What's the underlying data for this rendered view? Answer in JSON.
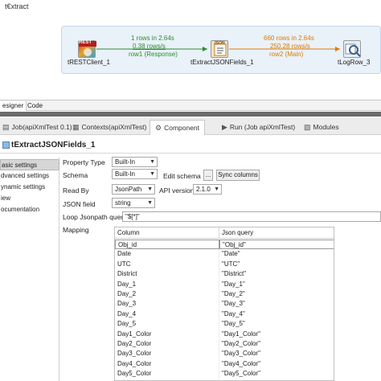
{
  "canvas": {
    "title": "t€xtract",
    "components": {
      "rest": {
        "label": "tRESTClient_1",
        "badge": "REST"
      },
      "extract": {
        "label": "tExtractJSONFields_1",
        "badge": "JSON"
      },
      "log": {
        "label": "tLogRow_3"
      }
    },
    "flow1": {
      "rows": "1 rows in 2.64s",
      "rate": "0.38 rows/s",
      "name": "row1 (Response)"
    },
    "flow2": {
      "rows": "660 rows in 2.64s",
      "rate": "250.28 rows/s",
      "name": "row2 (Main)"
    },
    "colors": {
      "flow_green": "#2e8b2e",
      "flow_orange": "#e07a00",
      "job_bg": "#e9f1f9"
    }
  },
  "designer_tabs": [
    "esigner",
    "Code"
  ],
  "view_tabs": [
    {
      "label": "Job(apiXmlTest 0.1)",
      "icon": "job-icon"
    },
    {
      "label": "Contexts(apiXmlTest)",
      "icon": "contexts-icon"
    },
    {
      "label": "Component",
      "icon": "component-icon"
    },
    {
      "label": "Run (Job apiXmlTest)",
      "icon": "run-icon"
    },
    {
      "label": "Modules",
      "icon": "modules-icon"
    }
  ],
  "component_title": "tExtractJSONFields_1",
  "settings_nav": [
    "asic settings",
    "dvanced settings",
    "ynamic settings",
    "iew",
    "ocumentation"
  ],
  "form": {
    "property_type_label": "Property Type",
    "property_type_value": "Built-In",
    "schema_label": "Schema",
    "schema_value": "Built-In",
    "edit_schema_label": "Edit schema",
    "edit_schema_btn": "...",
    "sync_columns_btn": "Sync columns",
    "read_by_label": "Read By",
    "read_by_value": "JsonPath",
    "api_version_label": "API version",
    "api_version_value": "2.1.0",
    "json_field_label": "JSON field",
    "json_field_value": "string",
    "loop_label": "Loop Jsonpath query",
    "loop_value": "\"$[*]\"",
    "mapping_label": "Mapping"
  },
  "mapping": {
    "headers": [
      "Column",
      "Json query"
    ],
    "rows": [
      [
        "Obj_id",
        "\"Obj_id\""
      ],
      [
        "Date",
        "\"Date\""
      ],
      [
        "UTC",
        "\"UTC\""
      ],
      [
        "District",
        "\"District\""
      ],
      [
        "Day_1",
        "\"Day_1\""
      ],
      [
        "Day_2",
        "\"Day_2\""
      ],
      [
        "Day_3",
        "\"Day_3\""
      ],
      [
        "Day_4",
        "\"Day_4\""
      ],
      [
        "Day_5",
        "\"Day_5\""
      ],
      [
        "Day1_Color",
        "\"Day1_Color\""
      ],
      [
        "Day2_Color",
        "\"Day2_Color\""
      ],
      [
        "Day3_Color",
        "\"Day3_Color\""
      ],
      [
        "Day4_Color",
        "\"Day4_Color\""
      ],
      [
        "Day5_Color",
        "\"Day5_Color\""
      ]
    ]
  }
}
